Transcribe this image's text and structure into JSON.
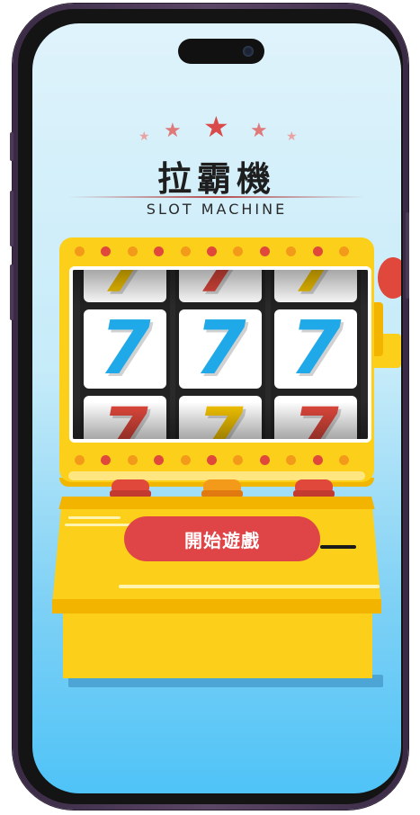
{
  "title": {
    "chinese": "拉霸機",
    "english": "SLOT MACHINE"
  },
  "decor": {
    "star_glyph": "★",
    "star_colors": [
      "#e8a3a3",
      "#e07a7a",
      "#d94a4a",
      "#e07a7a",
      "#e8a3a3"
    ]
  },
  "reels": [
    {
      "top": {
        "symbol": "7",
        "color": "#f5c400"
      },
      "center": {
        "symbol": "7",
        "color": "#1fa9e8"
      },
      "bottom": {
        "symbol": "7",
        "color": "#e0483c"
      }
    },
    {
      "top": {
        "symbol": "7",
        "color": "#e0483c"
      },
      "center": {
        "symbol": "7",
        "color": "#1fa9e8"
      },
      "bottom": {
        "symbol": "7",
        "color": "#f5c400"
      }
    },
    {
      "top": {
        "symbol": "7",
        "color": "#f5c400"
      },
      "center": {
        "symbol": "7",
        "color": "#1fa9e8"
      },
      "bottom": {
        "symbol": "7",
        "color": "#e0483c"
      }
    }
  ],
  "start_button": {
    "label": "開始遊戲"
  },
  "colors": {
    "machine_yellow": "#fcd01a",
    "accent_red": "#df4447",
    "accent_orange": "#f39a1b",
    "sky_top": "#dff3fb",
    "sky_bottom": "#4fc3f7"
  },
  "icons": {
    "lever": "lever-knob-icon",
    "push_buttons": [
      "red-push-button",
      "orange-push-button",
      "red-push-button"
    ]
  }
}
